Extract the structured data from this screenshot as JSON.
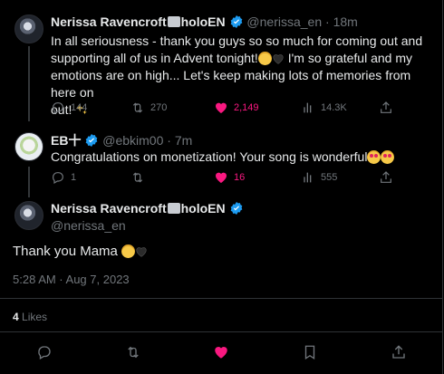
{
  "colors": {
    "background": "#000000",
    "text": "#e7e9ea",
    "muted": "#71767b",
    "accent": "#1d9bf0",
    "like": "#f91880"
  },
  "reply1": {
    "name": "Nerissa Ravencroft",
    "name_tag": "holoEN",
    "handle": "@nerissa_en",
    "time": "18m",
    "text_lines": [
      "In all seriousness - thank you guys so so much for coming out and",
      "supporting all of us in Advent tonight!",
      " I'm so grateful and my",
      "emotions are on high... Let's keep making lots of memories from here on",
      "out! "
    ],
    "replies": "144",
    "retweets": "270",
    "likes": "2,149",
    "views": "14.3K"
  },
  "reply2": {
    "name": "EB",
    "name_tag": "十",
    "handle": "@ebkim00",
    "time": "7m",
    "text": "Congratulations on monetization! Your song is wonderful",
    "replies": "1",
    "retweets": "",
    "likes": "16",
    "views": "555"
  },
  "main": {
    "name": "Nerissa Ravencroft",
    "name_tag": "holoEN",
    "handle": "@nerissa_en",
    "text": "Thank you Mama ",
    "timestamp": "5:28 AM · Aug 7, 2023",
    "like_count": "4",
    "like_label": "Likes",
    "sep": "·"
  },
  "icons": [
    "reply-icon",
    "retweet-icon",
    "like-icon",
    "views-icon",
    "share-icon",
    "bookmark-icon",
    "verified-icon"
  ]
}
